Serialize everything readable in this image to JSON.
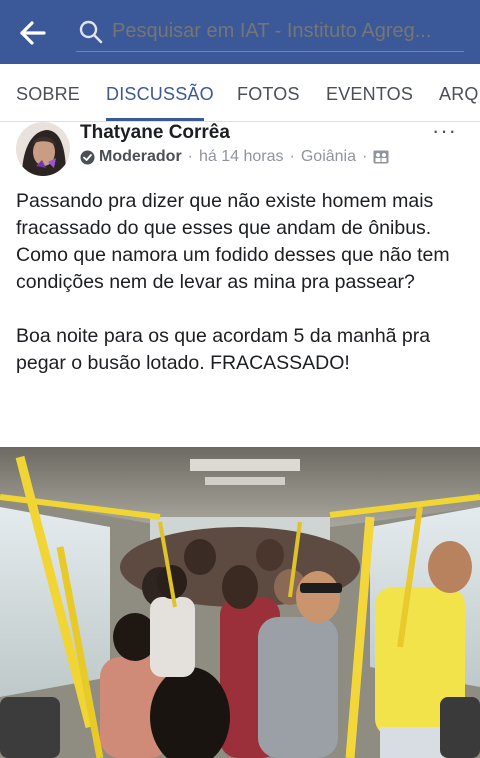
{
  "header": {
    "search_placeholder": "Pesquisar em IAT - Instituto Agreg...",
    "back_icon": "arrow-left-icon",
    "search_icon": "search-icon",
    "bar_color": "#3b5998"
  },
  "tabs": [
    {
      "label": "SOBRE"
    },
    {
      "label": "DISCUSSÃO",
      "active": true
    },
    {
      "label": "FOTOS"
    },
    {
      "label": "EVENTOS"
    },
    {
      "label": "ARQU"
    }
  ],
  "post": {
    "author": "Thatyane Corrêa",
    "role": "Moderador",
    "time": "há 14 horas",
    "location": "Goiânia",
    "more": "···",
    "paragraph1": "Passando pra dizer que não existe homem mais fracassado do que esses que andam de ônibus.\nComo que namora um fodido desses que não tem condições nem de levar as mina pra passear?",
    "paragraph2": "Boa noite para os que acordam 5 da manhã pra pegar o busão lotado. FRACASSADO!",
    "image_icon": "bus-photo"
  }
}
